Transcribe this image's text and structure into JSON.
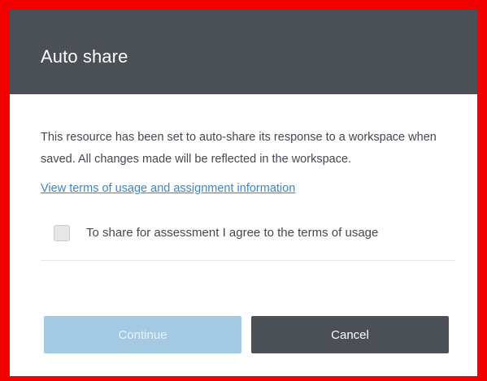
{
  "dialog": {
    "title": "Auto share",
    "message": "This resource has been set to auto-share its response to a workspace when saved. All changes made will be reflected in the workspace.",
    "terms_link": "View terms of usage and assignment information",
    "agree_checkbox": {
      "label": "To share for assessment I agree to the terms of usage",
      "checked": false
    },
    "continue_label": "Continue",
    "continue_state": "disabled",
    "cancel_label": "Cancel"
  },
  "colors": {
    "frame": "#f20000",
    "header_bg": "#4b4f56",
    "link": "#3c86c8",
    "continue_disabled_bg": "#a4c9e2",
    "cancel_bg": "#4b4f56"
  }
}
